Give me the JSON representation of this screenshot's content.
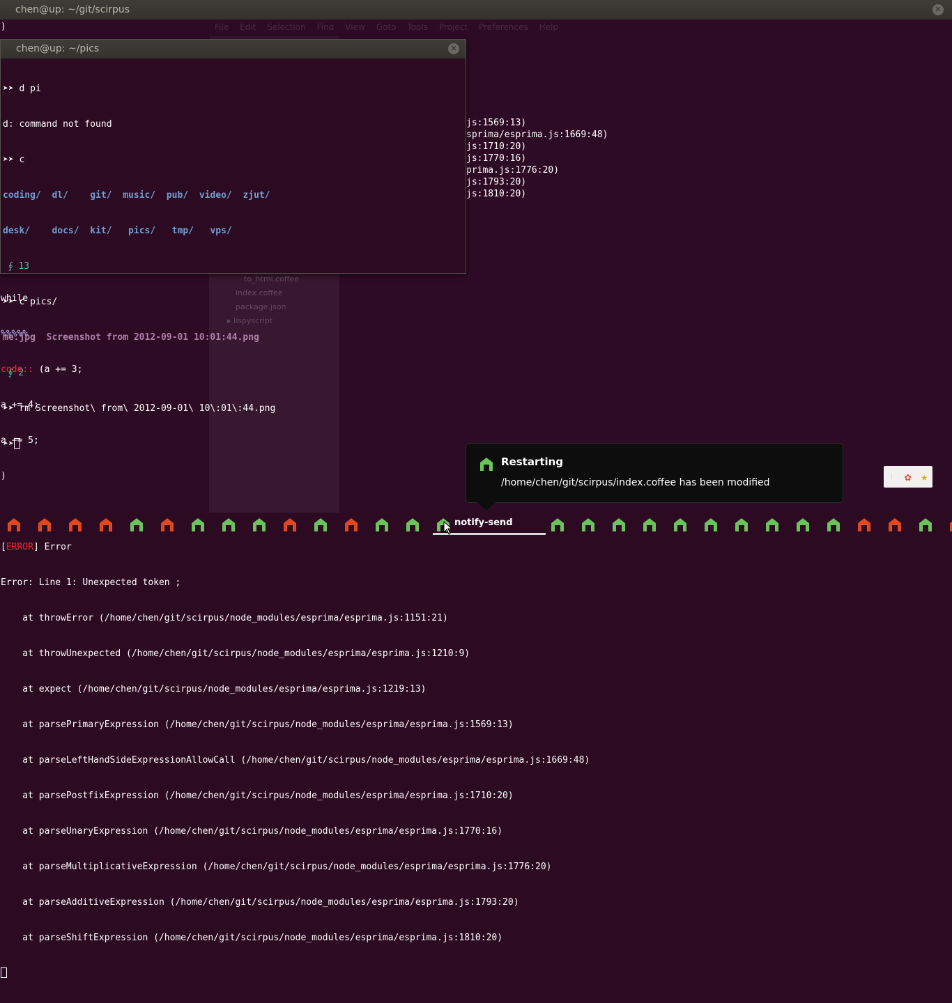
{
  "main_window": {
    "title": "chen@up: ~/git/scirpus",
    "lines": [
      ")",
      "",
      "",
      "",
      "",
      "",
      "",
      "",
      "",
      "",
      "",
      "",
      "",
      "",
      "",
      "",
      "",
      "",
      "",
      "",
      "",
      "",
      "",
      "",
      "",
      "",
      "",
      "",
      "",
      "",
      "",
      "",
      "",
      "",
      "",
      "",
      "",
      "",
      "",
      "",
      "",
      ""
    ],
    "right_fragments": [
      {
        "row": 5,
        "text": "js:1569:13)"
      },
      {
        "row": 6,
        "text": "sprima/esprima.js:1669:48)"
      },
      {
        "row": 7,
        "text": "js:1710:20)"
      },
      {
        "row": 8,
        "text": "js:1770:16)"
      },
      {
        "row": 9,
        "text": "prima.js:1776:20)"
      },
      {
        "row": 10,
        "text": "js:1793:20)"
      },
      {
        "row": 11,
        "text": "js:1810:20)"
      }
    ],
    "lower_lines": [
      "while",
      "%%%%%",
      "(a += 3;",
      "a += 4;",
      "a += 5;",
      ")",
      "",
      "Error",
      "Error: Line 1: Unexpected token ;",
      "    at throwError (/home/chen/git/scirpus/node_modules/esprima/esprima.js:1151:21)",
      "    at throwUnexpected (/home/chen/git/scirpus/node_modules/esprima/esprima.js:1210:9)",
      "    at expect (/home/chen/git/scirpus/node_modules/esprima/esprima.js:1219:13)",
      "    at parsePrimaryExpression (/home/chen/git/scirpus/node_modules/esprima/esprima.js:1569:13)",
      "    at parseLeftHandSideExpressionAllowCall (/home/chen/git/scirpus/node_modules/esprima/esprima.js:1669:48)",
      "    at parsePostfixExpression (/home/chen/git/scirpus/node_modules/esprima/esprima.js:1710:20)",
      "    at parseUnaryExpression (/home/chen/git/scirpus/node_modules/esprima/esprima.js:1770:16)",
      "    at parseMultiplicativeExpression (/home/chen/git/scirpus/node_modules/esprima/esprima.js:1776:20)",
      "    at parseAdditiveExpression (/home/chen/git/scirpus/node_modules/esprima/esprima.js:1793:20)",
      "    at parseShiftExpression (/home/chen/git/scirpus/node_modules/esprima/esprima.js:1810:20)"
    ],
    "code_label": "code::",
    "error_open": "[",
    "error_tag": "ERROR",
    "error_close": "]"
  },
  "ghost_editor": {
    "menu": [
      "File",
      "Edit",
      "Selection",
      "Find",
      "View",
      "Goto",
      "Tools",
      "Project",
      "Preferences",
      "Help"
    ],
    "files": [
      "to_html.coffee",
      "index.coffee",
      "package.json",
      "lispyscript"
    ]
  },
  "pics_window": {
    "title": "chen@up: ~/pics",
    "prompt": "➤➤",
    "lines": {
      "cmd1": "d pi",
      "out1": "d: command not found",
      "cmd2": "c",
      "dirs_row1": [
        "coding/",
        "dl/",
        "git/",
        "music/",
        "pub/",
        "video/",
        "zjut/"
      ],
      "dirs_row2": [
        "desk/",
        "docs/",
        "kit/",
        "pics/",
        "tmp/",
        "vps/"
      ],
      "status1": " ∮ 13",
      "cmd3": "c pics/",
      "files": [
        "me.jpg",
        "Screenshot from 2012-09-01 10:01:44.png"
      ],
      "status2": " ∮ 2",
      "cmd4": "rm Screenshot\\ from\\ 2012-09-01\\ 10\\:01\\:44.png"
    }
  },
  "notification": {
    "title": "Restarting",
    "body": "/home/chen/git/scirpus/index.coffee has been modified"
  },
  "dock": {
    "label": "notify-send",
    "icon_colors": {
      "red": "#e0481f",
      "green": "#6ac45b"
    },
    "icons": [
      "red",
      "red",
      "red",
      "red",
      "green",
      "red",
      "green",
      "green",
      "green",
      "red",
      "green",
      "red",
      "green",
      "green",
      "green",
      "green",
      "green",
      "green",
      "green",
      "green",
      "green",
      "green",
      "green",
      "green",
      "green",
      "red",
      "red",
      "green",
      "red"
    ]
  },
  "colors": {
    "background": "#2c0a22",
    "directory": "#729fcf",
    "image_file": "#ad7fa8",
    "error": "#ef2929"
  }
}
